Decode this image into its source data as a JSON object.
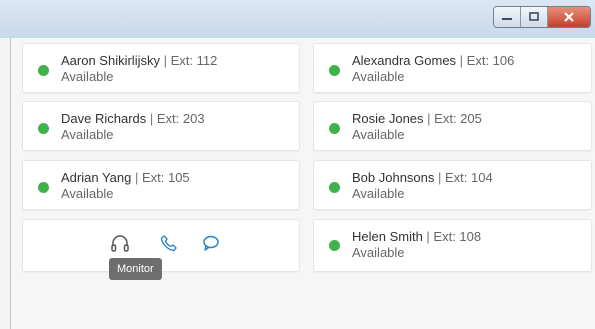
{
  "window": {
    "controls": [
      {
        "name": "minimize",
        "icon": "minimize-icon"
      },
      {
        "name": "maximize",
        "icon": "maximize-icon"
      },
      {
        "name": "close",
        "icon": "close-icon"
      }
    ]
  },
  "colors": {
    "available": "#3fb24b",
    "accent": "#2b86c5",
    "tooltip_bg": "#6e6e6e"
  },
  "contacts": [
    {
      "name": "Aaron Shikirlijsky",
      "separator": " | ",
      "ext": "Ext: 112",
      "status": "Available"
    },
    {
      "name": "Alexandra Gomes",
      "separator": " | ",
      "ext": "Ext: 106",
      "status": "Available"
    },
    {
      "name": "Dave Richards",
      "separator": " | ",
      "ext": "Ext: 203",
      "status": "Available"
    },
    {
      "name": "Rosie Jones",
      "separator": " | ",
      "ext": "Ext: 205",
      "status": "Available"
    },
    {
      "name": "Adrian Yang",
      "separator": " | ",
      "ext": "Ext: 105",
      "status": "Available"
    },
    {
      "name": "Bob Johnsons",
      "separator": " | ",
      "ext": "Ext: 104",
      "status": "Available"
    },
    {
      "name": "Helen Smith",
      "separator": " | ",
      "ext": "Ext: 108",
      "status": "Available"
    }
  ],
  "action_card": {
    "icons": [
      "headset-icon",
      "phone-icon",
      "chat-bubble-icon"
    ],
    "tooltip": "Monitor"
  }
}
